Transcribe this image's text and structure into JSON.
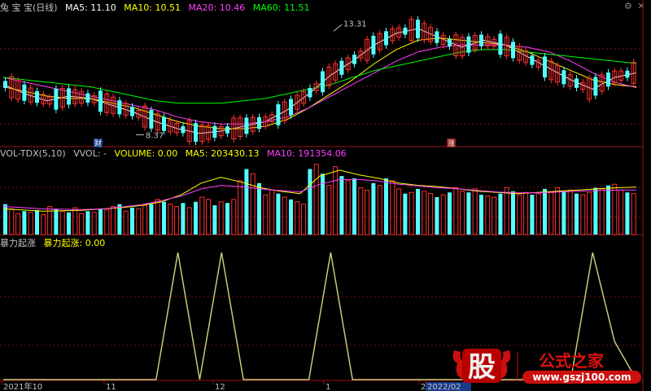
{
  "main_legend": {
    "title": "兔 宝 宝(日线)",
    "ma5": "MA5: 11.10",
    "ma10": "MA10: 10.51",
    "ma20": "MA20: 10.46",
    "ma60": "MA60: 11.51",
    "colors": {
      "title": "#c0c0c0",
      "ma5": "#ffffff",
      "ma10": "#ffff00",
      "ma20": "#ff40ff",
      "ma60": "#00ff00"
    }
  },
  "volume_legend": {
    "title": "VOL-TDX(5,10)",
    "vvol": "VVOL: -",
    "volume": "VOLUME: 0.00",
    "ma5": "MA5: 203430.13",
    "ma10": "MA10: 191354.06"
  },
  "indicator_legend": {
    "title": "暴力起涨",
    "label": "暴力起涨: 0.00"
  },
  "annotations": {
    "high": "13.31",
    "low": "8.37",
    "cai": "财",
    "zhang": "涨"
  },
  "x_axis": {
    "labels": [
      "2021年10",
      "11",
      "12",
      "1",
      "2",
      "2022/02"
    ]
  },
  "logo": {
    "glyph": "股",
    "name": "公式之家",
    "url": "www.gszj100.com"
  },
  "chart_data": [
    {
      "type": "line",
      "title": "兔 宝 宝(日线)",
      "series": [
        {
          "name": "MA5",
          "values": [
            10.6,
            10.2,
            9.9,
            10.1,
            10.0,
            9.7,
            9.4,
            9.0,
            8.7,
            8.5,
            8.6,
            8.8,
            9.0,
            9.5,
            10.2,
            11.0,
            11.6,
            12.3,
            12.8,
            13.0,
            12.6,
            12.2,
            12.5,
            12.3,
            11.8,
            11.3,
            10.8,
            10.4,
            10.9,
            11.1
          ]
        },
        {
          "name": "MA10",
          "values": [
            10.5,
            10.3,
            10.1,
            10.0,
            10.0,
            9.8,
            9.6,
            9.3,
            9.0,
            8.8,
            8.7,
            8.7,
            8.8,
            9.1,
            9.6,
            10.2,
            10.8,
            11.5,
            12.1,
            12.5,
            12.6,
            12.5,
            12.4,
            12.3,
            12.0,
            11.6,
            11.2,
            10.8,
            10.6,
            10.5
          ]
        },
        {
          "name": "MA20",
          "values": [
            10.9,
            10.7,
            10.5,
            10.3,
            10.1,
            9.9,
            9.7,
            9.5,
            9.2,
            9.0,
            8.9,
            8.9,
            9.0,
            9.2,
            9.6,
            10.1,
            10.6,
            11.1,
            11.6,
            12.0,
            12.2,
            12.3,
            12.3,
            12.3,
            12.2,
            12.0,
            11.6,
            11.1,
            10.7,
            10.46
          ]
        },
        {
          "name": "MA60",
          "values": [
            10.9,
            10.8,
            10.7,
            10.6,
            10.5,
            10.3,
            10.1,
            9.9,
            9.8,
            9.8,
            9.8,
            9.9,
            10.0,
            10.2,
            10.4,
            10.6,
            10.9,
            11.2,
            11.4,
            11.6,
            11.8,
            12.0,
            12.1,
            12.1,
            12.0,
            11.9,
            11.8,
            11.7,
            11.6,
            11.51
          ]
        }
      ],
      "price_high": 13.31,
      "price_low": 8.37
    },
    {
      "type": "bar",
      "title": "VOL-TDX(5,10)",
      "values": [
        130,
        110,
        90,
        100,
        95,
        105,
        85,
        120,
        110,
        100,
        95,
        115,
        90,
        100,
        95,
        110,
        105,
        120,
        130,
        100,
        115,
        110,
        125,
        130,
        150,
        140,
        130,
        120,
        135,
        115,
        140,
        160,
        150,
        125,
        140,
        135,
        150,
        230,
        280,
        260,
        220,
        170,
        190,
        175,
        160,
        150,
        140,
        130,
        280,
        300,
        260,
        210,
        290,
        250,
        230,
        240,
        200,
        190,
        220,
        210,
        240,
        230,
        195,
        175,
        180,
        195,
        185,
        175,
        160,
        170,
        180,
        200,
        185,
        180,
        195,
        170,
        165,
        160,
        175,
        200,
        185,
        170,
        180,
        170,
        175,
        195,
        180,
        200,
        185,
        190,
        175,
        170,
        180,
        200,
        195,
        210,
        215,
        190,
        180,
        175
      ],
      "series": [
        {
          "name": "MA5",
          "values": [
            110,
            105,
            100,
            102,
            104,
            110,
            115,
            125,
            140,
            170,
            220,
            245,
            225,
            200,
            185,
            175,
            250,
            275,
            255,
            240,
            220,
            210,
            205,
            195,
            185,
            180,
            175,
            180,
            185,
            190,
            195,
            200,
            203
          ]
        },
        {
          "name": "MA10",
          "values": [
            120,
            115,
            110,
            108,
            107,
            110,
            118,
            128,
            145,
            165,
            195,
            210,
            205,
            195,
            188,
            182,
            215,
            235,
            235,
            228,
            215,
            208,
            200,
            195,
            188,
            182,
            178,
            178,
            182,
            185,
            188,
            190,
            191
          ]
        }
      ]
    },
    {
      "type": "line",
      "title": "暴力起涨",
      "series": [
        {
          "name": "暴力起涨",
          "values": [
            0,
            0,
            0,
            0,
            0,
            0,
            0,
            0,
            1,
            0,
            1,
            0,
            0,
            0,
            0,
            1,
            0,
            0,
            0,
            0,
            0,
            0,
            0,
            0,
            0,
            0,
            0,
            1,
            0.3,
            0
          ]
        }
      ]
    }
  ]
}
